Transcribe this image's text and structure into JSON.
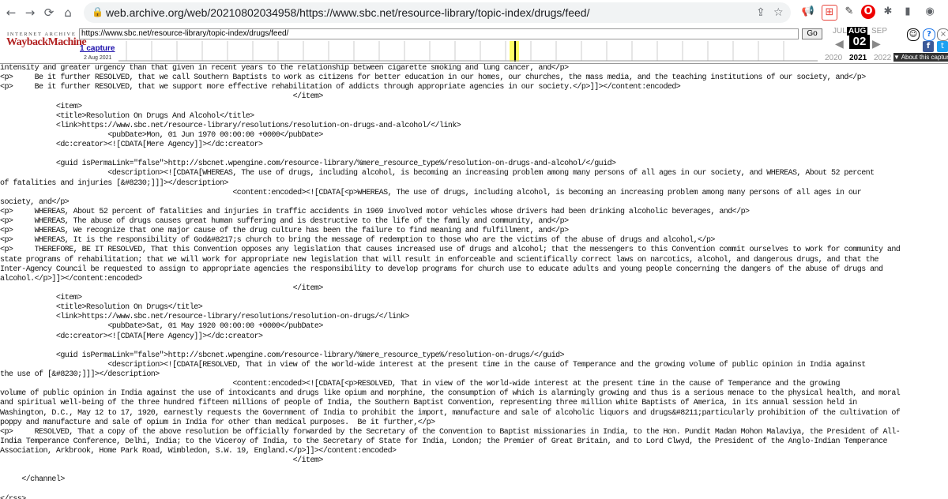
{
  "browser": {
    "url": "web.archive.org/web/20210802034958/https://www.sbc.net/resource-library/topic-index/drugs/feed/",
    "back_icon": "back-arrow-icon",
    "forward_icon": "forward-arrow-icon",
    "reload_icon": "reload-icon",
    "home_icon": "home-icon"
  },
  "wayback": {
    "ia_label": "INTERNET ARCHIVE",
    "logo_text": "WaybackMachine",
    "url_value": "https://www.sbc.net/resource-library/topic-index/drugs/feed/",
    "go_label": "Go",
    "captures_label": "1 capture",
    "capture_date": "2 Aug 2021",
    "months": {
      "prev": "JUL",
      "current": "AUG",
      "next": "SEP"
    },
    "day": "02",
    "years": {
      "prev": "2020",
      "current": "2021",
      "next": "2022"
    },
    "about_label": "▼ About this capture",
    "accent_color": "#b22222",
    "highlight_color": "#ffff66"
  },
  "content": {
    "lines": [
      "intensity and greater urgency than that given in recent years to the relationship between cigarette smoking and lung cancer, and</p>",
      "<p>     Be it further RESOLVED, that we call Southern Baptists to work as citizens for better education in our homes, our churches, the mass media, and the teaching institutions of our society, and</p>",
      "<p>     Be it further RESOLVED, that we support more effective rehabilitation of addicts through appropriate agencies in our society.</p>]]></content:encoded>",
      "                                                                    </item>",
      "             <item>",
      "             <title>Resolution On Drugs And Alcohol</title>",
      "             <link>https://www.sbc.net/resource-library/resolutions/resolution-on-drugs-and-alcohol/</link>",
      "                         <pubDate>Mon, 01 Jun 1970 00:00:00 +0000</pubDate>",
      "             <dc:creator><![CDATA[Mere Agency]]></dc:creator>",
      "",
      "             <guid isPermaLink=\"false\">http://sbcnet.wpengine.com/resource-library/%mere_resource_type%/resolution-on-drugs-and-alcohol/</guid>",
      "                         <description><![CDATA[WHEREAS, The use of drugs, including alcohol, is becoming an increasing problem among many persons of all ages in our society, and WHEREAS, About 52 percent",
      "of fatalities and injuries [&#8230;]]]></description>",
      "                                                      <content:encoded><![CDATA[<p>WHEREAS, The use of drugs, including alcohol, is becoming an increasing problem among many persons of all ages in our",
      "society, and</p>",
      "<p>     WHEREAS, About 52 percent of fatalities and injuries in traffic accidents in 1969 involved motor vehicles whose drivers had been drinking alcoholic beverages, and</p>",
      "<p>     WHEREAS, The abuse of drugs causes great human suffering and is destructive to the life of the family and community, and</p>",
      "<p>     WHEREAS, We recognize that one major cause of the drug culture has been the failure to find meaning and fulfillment, and</p>",
      "<p>     WHEREAS, It is the responsibility of God&#8217;s church to bring the message of redemption to those who are the victims of the abuse of drugs and alcohol,</p>",
      "<p>     THEREFORE, BE IT RESOLVED, That this Convention opposes any legislation that causes increased use of drugs and alcohol; that the messengers to this Convention commit ourselves to work for community and",
      "state programs of rehabilitation; that we will work for appropriate new legislation that will result in enforceable and scientifically correct laws on narcotics, alcohol, and dangerous drugs, and that the",
      "Inter-Agency Council be requested to assign to appropriate agencies the responsibility to develop programs for church use to educate adults and young people concerning the dangers of the abuse of drugs and",
      "alcohol.</p>]]></content:encoded>",
      "                                                                    </item>",
      "             <item>",
      "             <title>Resolution On Drugs</title>",
      "             <link>https://www.sbc.net/resource-library/resolutions/resolution-on-drugs/</link>",
      "                         <pubDate>Sat, 01 May 1920 00:00:00 +0000</pubDate>",
      "             <dc:creator><![CDATA[Mere Agency]]></dc:creator>",
      "",
      "             <guid isPermaLink=\"false\">http://sbcnet.wpengine.com/resource-library/%mere_resource_type%/resolution-on-drugs/</guid>",
      "                         <description><![CDATA[RESOLVED, That in view of the world-wide interest at the present time in the cause of Temperance and the growing volume of public opinion in India against",
      "the use of [&#8230;]]]></description>",
      "                                                      <content:encoded><![CDATA[<p>RESOLVED, That in view of the world-wide interest at the present time in the cause of Temperance and the growing",
      "volume of public opinion in India against the use of intoxicants and drugs like opium and morphine, the consumption of which is alarmingly growing and thus is a serious menace to the physical health, and moral",
      "and spiritual well-being of the three hundred fifteen millions of people of India, the Southern Baptist Convention, representing three million white Baptists of America, in its annual session held in",
      "Washington, D.C., May 12 to 17, 1920, earnestly requests the Government of India to prohibit the import, manufacture and sale of alcoholic liquors and drugs&#8211;particularly prohibition of the cultivation of",
      "poppy and manufacture and sale of opium in India for other than medical purposes.  Be it further,</p>",
      "<p>     RESOLVED, That a copy of the above resolution be officially forwarded by the Secretary of the Convention to Baptist missionaries in India, to the Hon. Pundit Madan Mohon Malaviya, the President of All-",
      "India Temperance Conference, Delhi, India; to the Viceroy of India, to the Secretary of State for India, London; the Premier of Great Britain, and to Lord Clwyd, the President of the Anglo-Indian Temperance",
      "Association, Arkbrook, Home Park Road, Wimbledon, S.W. 19, England.</p>]]></content:encoded>",
      "                                                                    </item>",
      "",
      "     </channel>",
      "",
      "</rss>"
    ]
  }
}
